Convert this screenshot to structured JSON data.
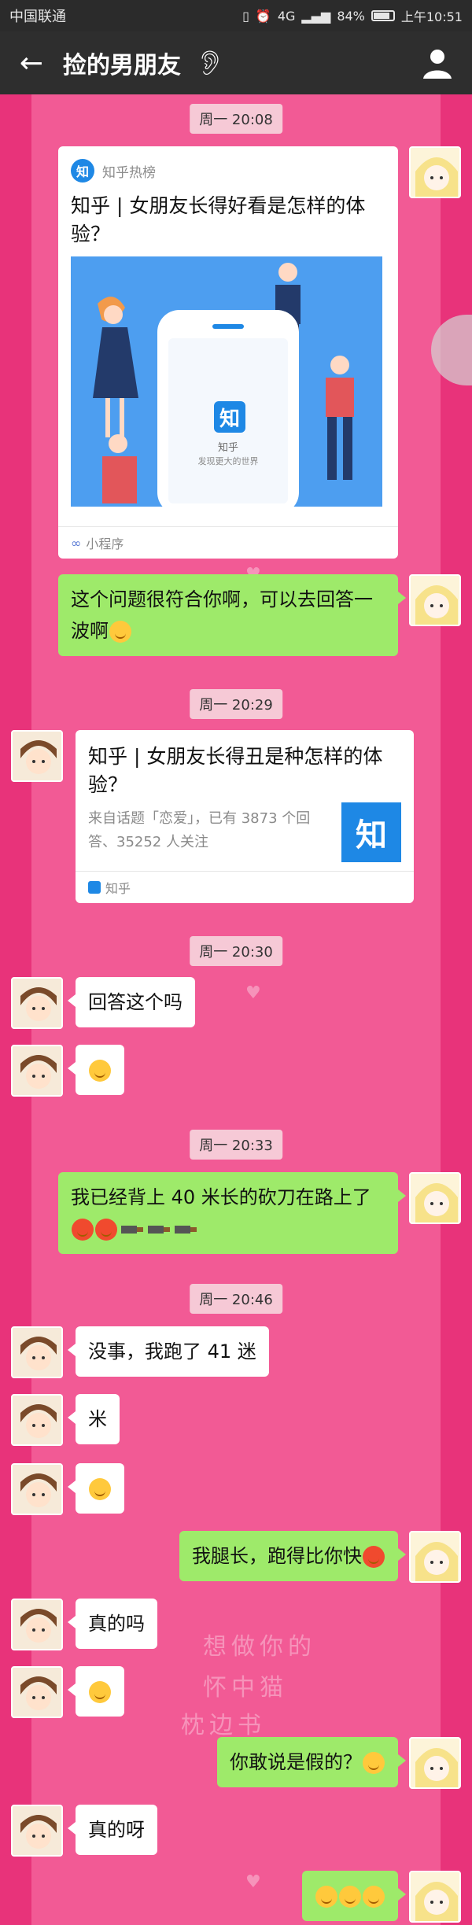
{
  "status_bar": {
    "carrier": "中国联通",
    "network": "4G",
    "battery": "84%",
    "time": "上午10:51"
  },
  "nav": {
    "title": "捡的男朋友"
  },
  "times": [
    "周一 20:08",
    "周一 20:29",
    "周一 20:30",
    "周一 20:33",
    "周一 20:46"
  ],
  "card1": {
    "source": "知乎热榜",
    "logo": "知",
    "title": "知乎 | 女朋友长得好看是怎样的体验？",
    "app_icon": "知",
    "app_name": "知乎",
    "app_slogan": "发现更大的世界",
    "footer": "小程序"
  },
  "card2": {
    "title": "知乎 | 女朋友长得丑是种怎样的体验？",
    "desc": "来自话题「恋爱」，已有 3873 个回答、35252 人关注",
    "thumb": "知",
    "footer": "知乎"
  },
  "messages": {
    "m1": "这个问题很符合你啊，可以去回答一波啊",
    "m2": "回答这个吗",
    "m3": "我已经背上 40 米长的砍刀在路上了",
    "m4": "没事，我跑了 41 迷",
    "m5": "米",
    "m6": "我腿长，跑得比你快",
    "m7": "真的吗",
    "m8": "你敢说是假的？",
    "m9": "真的呀"
  },
  "background_text": [
    "想做你的",
    "怀中猫",
    "枕边书"
  ],
  "colors": {
    "background": "#f25a95",
    "green_bubble": "#9eea6a",
    "navbar": "#2e2e2e",
    "zhihu_blue": "#1e88e5"
  }
}
